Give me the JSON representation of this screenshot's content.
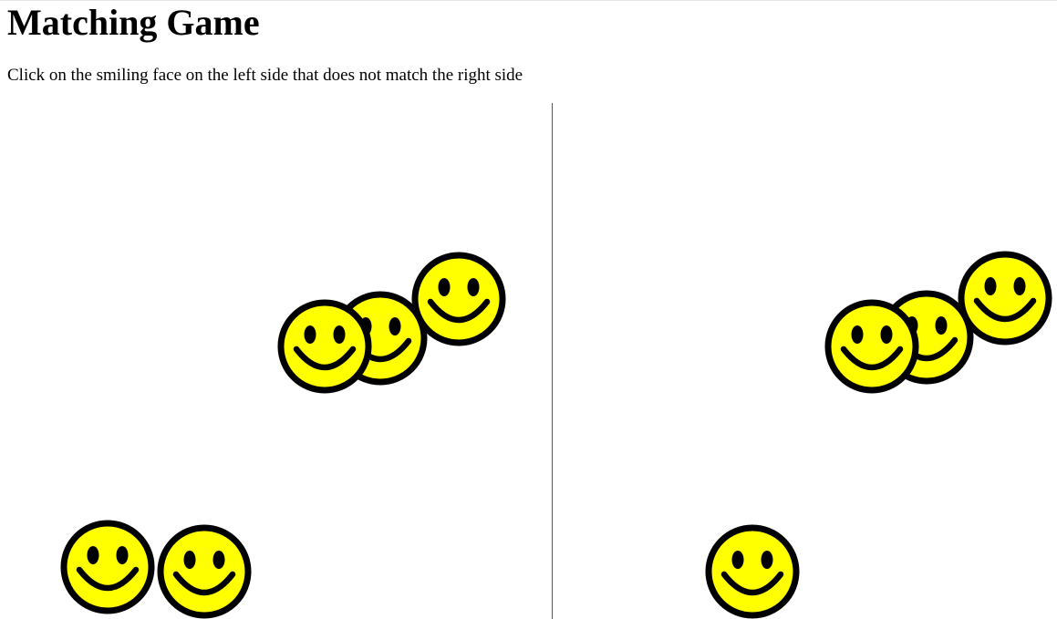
{
  "title": "Matching Game",
  "instructions": "Click on the smiling face on the left side that does not match the right side",
  "colors": {
    "face_fill": "#ffff00",
    "face_stroke": "#000000",
    "divider": "#555555"
  },
  "icon": "smiley-face-icon",
  "left_side": {
    "face_count": 5
  },
  "right_side": {
    "face_count": 4
  }
}
